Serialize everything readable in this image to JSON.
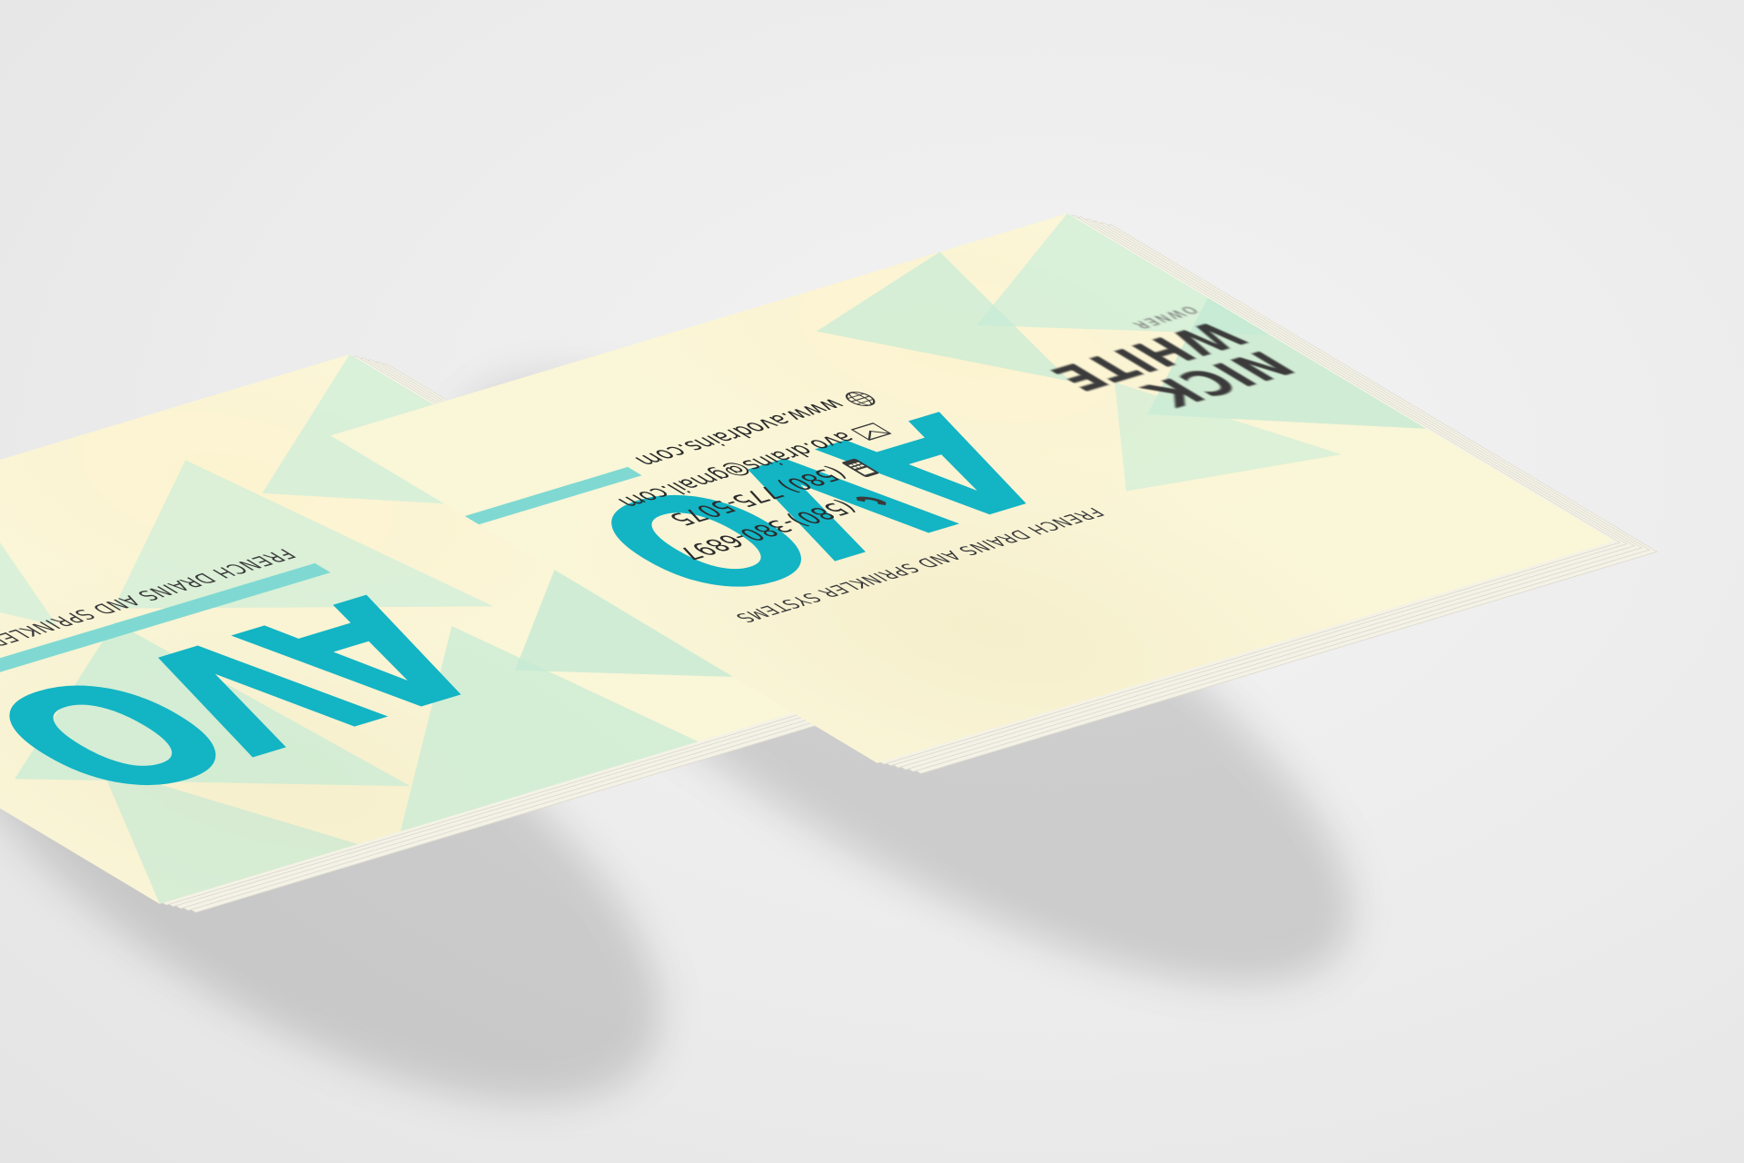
{
  "front_card": {
    "name_first": "NICK",
    "name_last": "WHITE",
    "title": "OWNER",
    "logo": "AVO",
    "tagline": "FRENCH DRAINS AND SPRINKLER SYSTEMS",
    "phone_1": "(580)-380-6897",
    "phone_2": "(580) 775-5075",
    "email": "avo.drains@gmail.com",
    "website": "www.avodrains.com",
    "icons": [
      "phone-icon",
      "mobile-icon",
      "envelope-icon",
      "globe-icon"
    ]
  },
  "back_card": {
    "logo": "AVO",
    "tagline": "FRENCH DRAINS AND SPRINKLER SYSTEMS"
  },
  "colors": {
    "logo_teal": "#13b4c4",
    "bar_mint": "#7fd9d2",
    "triangle_mint": "#cdeed9",
    "card_cream": "#faf6d8",
    "text_dark": "#2b2b2b",
    "background": "#ededed"
  }
}
